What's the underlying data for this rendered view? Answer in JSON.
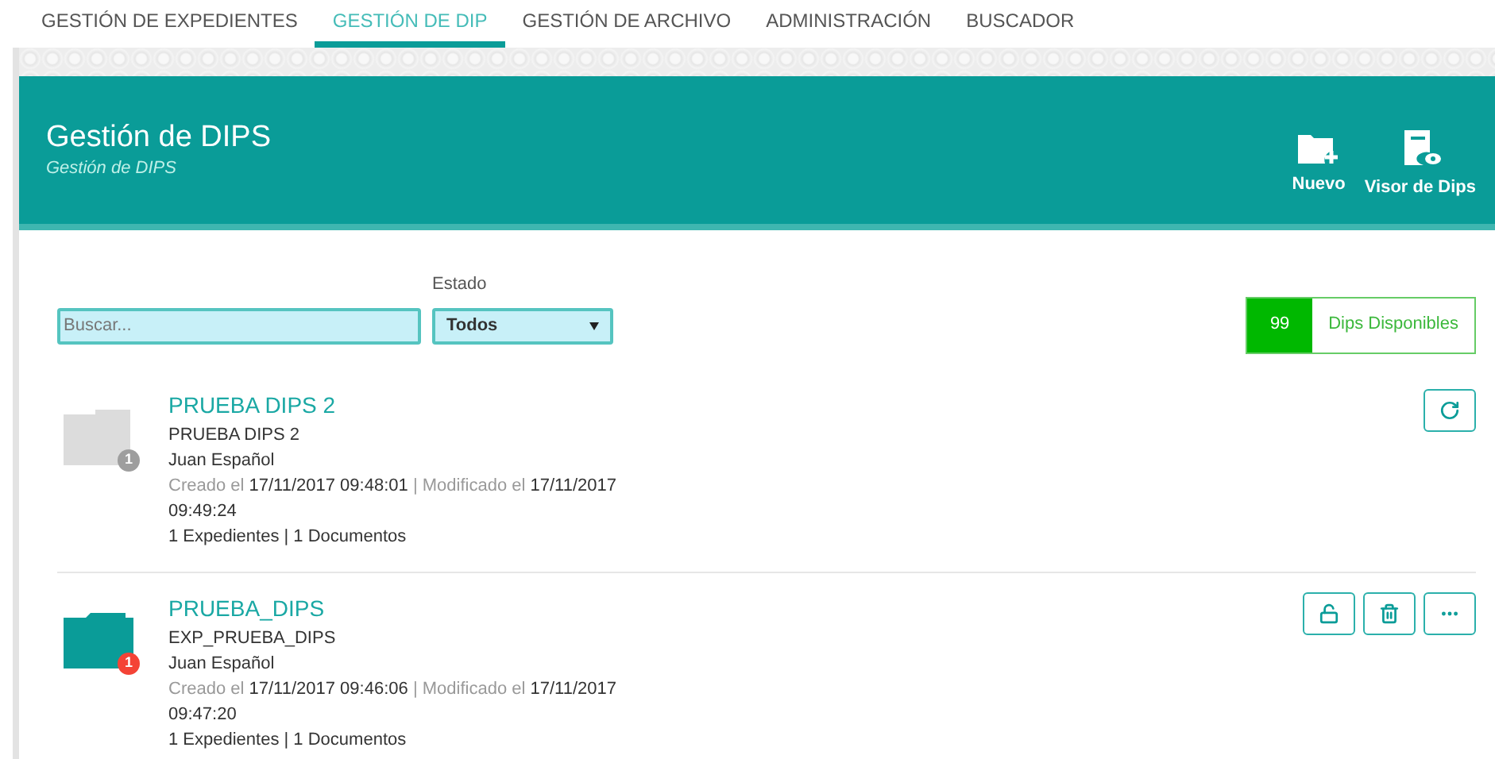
{
  "nav_tabs": [
    {
      "label": "GESTIÓN DE EXPEDIENTES",
      "selected": false
    },
    {
      "label": "GESTIÓN DE DIP",
      "selected": true
    },
    {
      "label": "GESTIÓN DE ARCHIVO",
      "selected": false
    },
    {
      "label": "ADMINISTRACIÓN",
      "selected": false
    },
    {
      "label": "BUSCADOR",
      "selected": false
    }
  ],
  "header": {
    "title": "Gestión de DIPS",
    "subtitle": "Gestión de DIPS",
    "actions": [
      {
        "kind": "new",
        "label": "Nuevo"
      },
      {
        "kind": "viewer",
        "label": "Visor de Dips"
      }
    ]
  },
  "filters": {
    "search": {
      "placeholder": "Buscar..."
    },
    "state": {
      "label": "Estado",
      "value": "Todos"
    }
  },
  "available": {
    "count": "99",
    "label": "Dips Disponibles"
  },
  "items": [
    {
      "title": "PRUEBA DIPS 2",
      "subtitle": "PRUEBA DIPS 2",
      "author": "Juan Español",
      "created_label": "Creado el",
      "created": "17/11/2017 09:48:01",
      "separator": "|",
      "modified_label": "Modificado el",
      "modified": "17/11/2017 09:49:24",
      "counts": "1 Expedientes | 1 Documentos",
      "kind": "empty",
      "badge": "1",
      "color": "#9e9e9e",
      "actions": [
        {
          "kind": "refresh"
        }
      ]
    },
    {
      "title": "PRUEBA_DIPS",
      "subtitle": "EXP_PRUEBA_DIPS",
      "author": "Juan Español",
      "created_label": "Creado el",
      "created": "17/11/2017 09:46:06",
      "separator": "|",
      "modified_label": "Modificado el",
      "modified": "17/11/2017 09:47:20",
      "counts": "1 Expedientes | 1 Documentos",
      "kind": "full",
      "badge": "1",
      "color": "#f44336",
      "actions": [
        {
          "kind": "unlock"
        },
        {
          "kind": "delete"
        },
        {
          "kind": "more"
        }
      ]
    }
  ]
}
